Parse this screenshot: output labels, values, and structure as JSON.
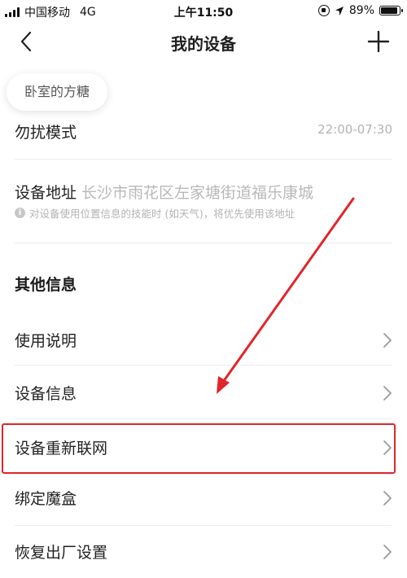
{
  "status_bar": {
    "carrier": "中国移动",
    "network": "4G",
    "time": "上午11:50",
    "battery_percent_text": "89%",
    "battery_level": 0.89
  },
  "nav": {
    "title": "我的设备"
  },
  "chip": {
    "label": "卧室的方糖"
  },
  "settings": {
    "dnd": {
      "label": "勿扰模式",
      "value": "22:00-07:30"
    },
    "address": {
      "label": "设备地址",
      "value": "长沙市雨花区左家塘街道福乐康城",
      "hint": "对设备使用位置信息的技能时 (如天气)，将优先使用该地址"
    }
  },
  "other_info": {
    "title": "其他信息",
    "items": [
      {
        "label": "使用说明"
      },
      {
        "label": "设备信息"
      },
      {
        "label": "设备重新联网"
      },
      {
        "label": "绑定魔盒"
      },
      {
        "label": "恢复出厂设置"
      }
    ]
  },
  "colors": {
    "annotation_red": "#e1252a"
  },
  "icons": [
    "signal-icon",
    "rotation-lock-icon",
    "location-icon",
    "battery-icon",
    "back-icon",
    "plus-icon",
    "info-icon",
    "chevron-right-icon"
  ]
}
